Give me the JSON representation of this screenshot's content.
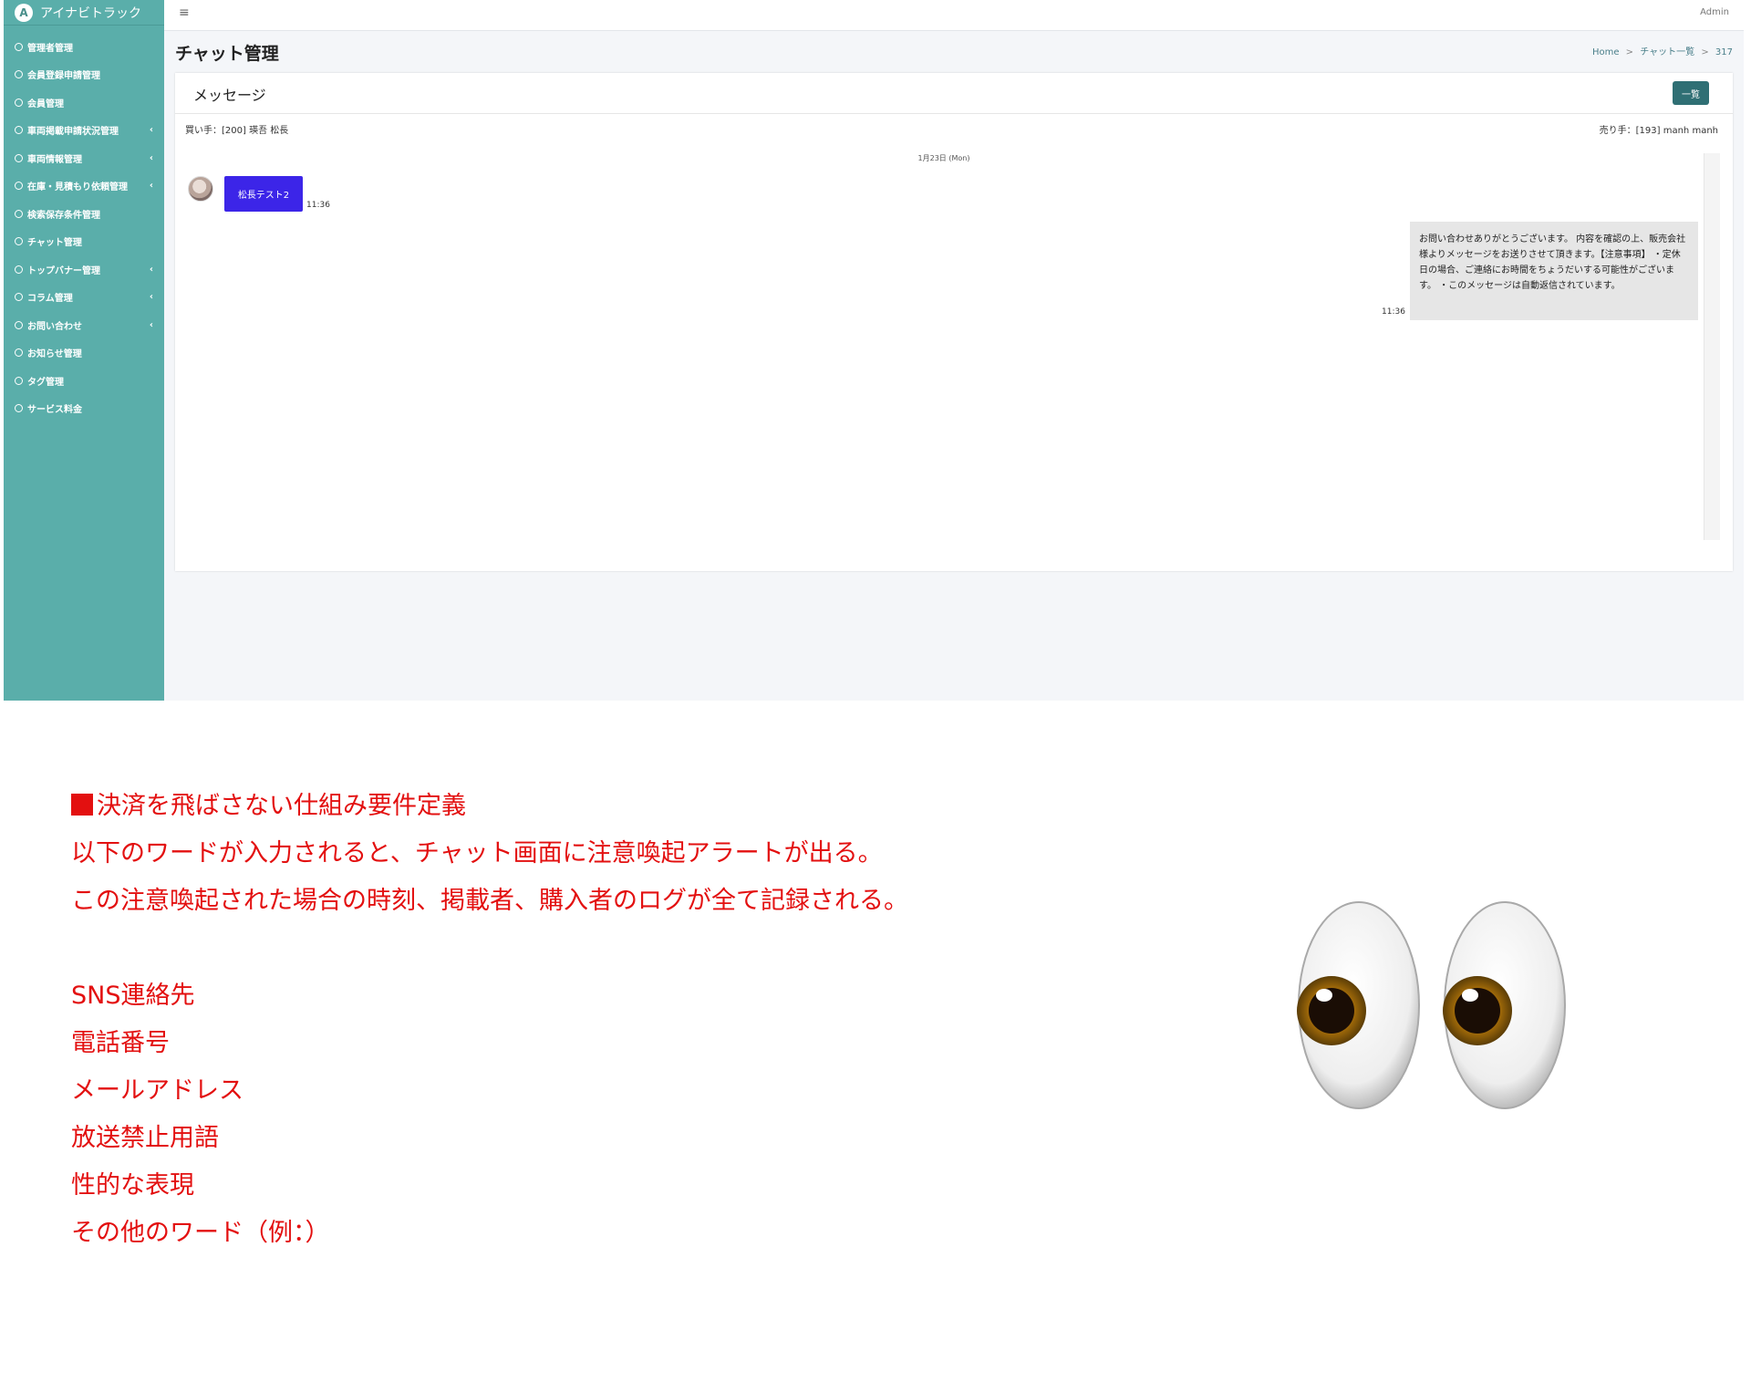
{
  "brand": {
    "logo_letter": "A",
    "name": "アイナビトラック"
  },
  "sidebar": {
    "items": [
      {
        "label": "管理者管理",
        "has_sub": false
      },
      {
        "label": "会員登録申請管理",
        "has_sub": false
      },
      {
        "label": "会員管理",
        "has_sub": false
      },
      {
        "label": "車両掲載申請状況管理",
        "has_sub": true
      },
      {
        "label": "車両情報管理",
        "has_sub": true
      },
      {
        "label": "在庫・見積もり依頼管理",
        "has_sub": true
      },
      {
        "label": "検索保存条件管理",
        "has_sub": false
      },
      {
        "label": "チャット管理",
        "has_sub": false
      },
      {
        "label": "トップバナー管理",
        "has_sub": true
      },
      {
        "label": "コラム管理",
        "has_sub": true
      },
      {
        "label": "お問い合わせ",
        "has_sub": true
      },
      {
        "label": "お知らせ管理",
        "has_sub": false
      },
      {
        "label": "タグ管理",
        "has_sub": false
      },
      {
        "label": "サービス料金",
        "has_sub": false
      }
    ]
  },
  "topbar": {
    "menu_glyph": "≡",
    "user": "Admin"
  },
  "page": {
    "title": "チャット管理"
  },
  "breadcrumb": {
    "home": "Home",
    "sep": ">",
    "list": "チャット一覧",
    "id": "317"
  },
  "card": {
    "title": "メッセージ",
    "list_button": "一覧"
  },
  "chat": {
    "buyer": "買い手：[200] 瑛吾 松長",
    "seller": "売り手：[193] manh manh",
    "date": "1月23日 (Mon)",
    "incoming": {
      "text": "松長テスト2",
      "time": "11:36"
    },
    "outgoing": {
      "text": "お問い合わせありがとうございます。 内容を確認の上、販売会社様よりメッセージをお送りさせて頂きます。【注意事項】 ・定休日の場合、ご連絡にお時間をちょうだいする可能性がございます。 ・このメッセージは自動返信されています。",
      "time": "11:36"
    }
  },
  "notes": {
    "heading": "決済を飛ばさない仕組み要件定義",
    "line1": "以下のワードが入力されると、チャット画面に注意喚起アラートが出る。",
    "line2": "この注意喚起された場合の時刻、掲載者、購入者のログが全て記録される。",
    "words": [
      "SNS連絡先",
      "電話番号",
      "メールアドレス",
      "放送禁止用語",
      "性的な表現",
      "その他のワード（例：）"
    ]
  },
  "colors": {
    "sidebar": "#5aaeaa",
    "accent": "#3c25e8",
    "note_red": "#e31010",
    "button": "#2f6f74"
  },
  "decoration": {
    "emoji": "eyes-emoji"
  }
}
